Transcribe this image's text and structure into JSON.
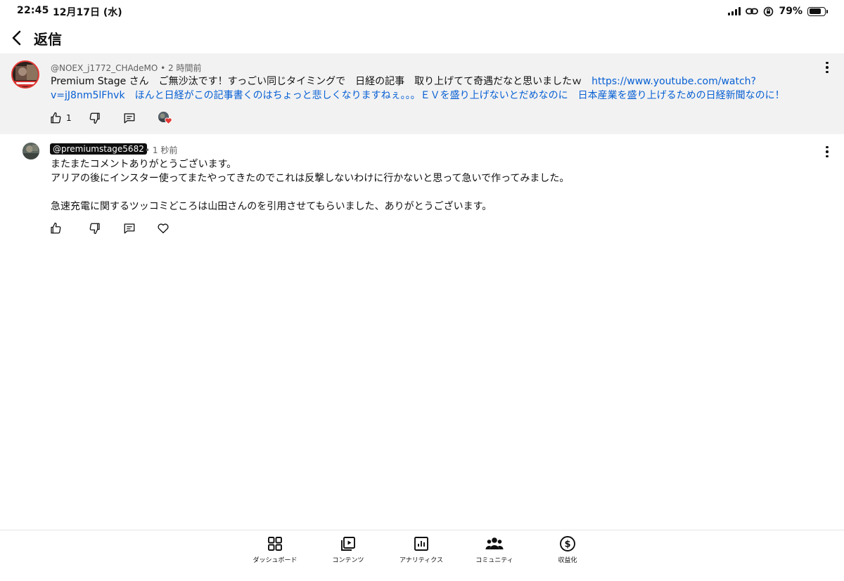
{
  "status_bar": {
    "time": "22:45",
    "date": "12月17日 (水)",
    "battery": "79%",
    "battery_level": 0.79
  },
  "header": {
    "back_icon": "chevron-left-icon",
    "title": "返信"
  },
  "parent_comment": {
    "author": "@NOEX_j1772_CHAdeMO",
    "separator": "•",
    "time": "2 時間前",
    "text_before_link": "Premium Stage さん　ご無沙汰です！すっごい同じタイミングで　日経の記事　取り上げてて奇遇だなと思いましたｗ　",
    "link": "https://www.youtube.com/watch?v=jJ8nm5lFhvk",
    "text_after_link": "　ほんと日経がこの記事書くのはちょっと悲しくなりますねぇ。。。ＥＶを盛り上げないとだめなのに　日本産業を盛り上げるための日経新聞なのに！",
    "like_count": "1",
    "heart_color": "#e53935",
    "link_color": "#065fd4"
  },
  "reply": {
    "author": "@premiumstage5682",
    "separator": "•",
    "time": "1 秒前",
    "lines": [
      "またまたコメントありがとうございます。",
      "アリアの後にインスター使ってまたやってきたのでこれは反撃しないわけに行かないと思って急いで作ってみました。",
      "急速充電に関するツッコミどころは山田さんのを引用させてもらいました、ありがとうございます。"
    ]
  },
  "bottom_nav": [
    {
      "label": "ダッシュボード",
      "icon": "dashboard-icon"
    },
    {
      "label": "コンテンツ",
      "icon": "content-icon"
    },
    {
      "label": "アナリティクス",
      "icon": "analytics-icon"
    },
    {
      "label": "コミュニティ",
      "icon": "community-icon"
    },
    {
      "label": "収益化",
      "icon": "dollar-icon"
    }
  ]
}
